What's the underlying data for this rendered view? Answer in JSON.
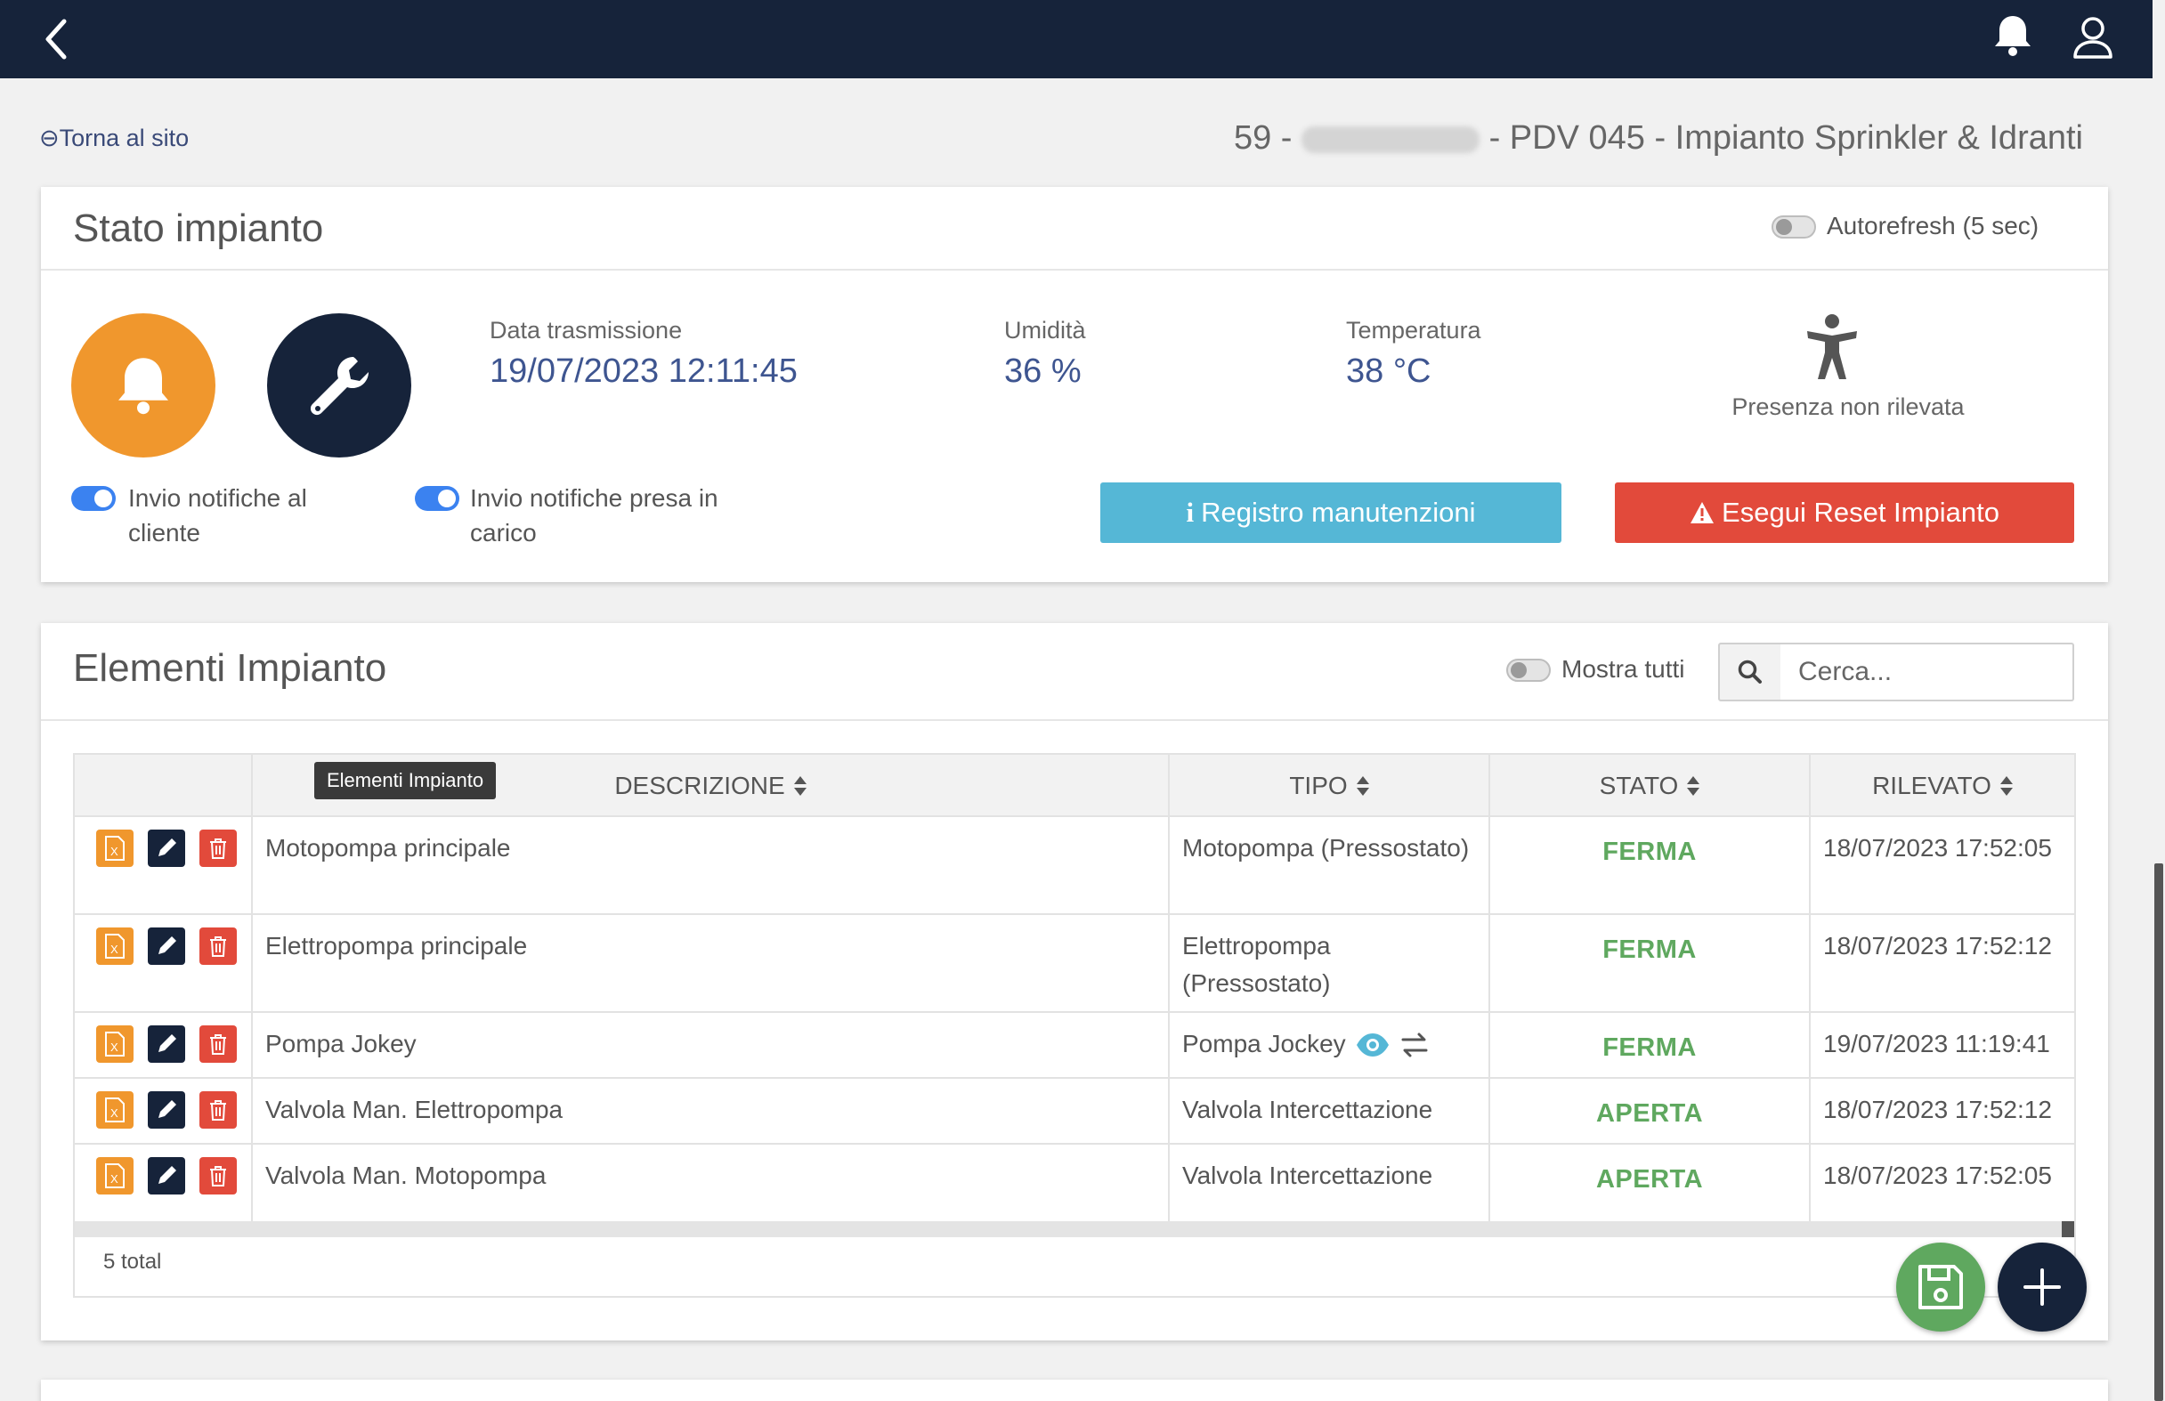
{
  "back_link": "⊖Torna al sito",
  "page_heading": {
    "prefix": "59 -",
    "suffix": "- PDV 045 - Impianto Sprinkler & Idranti"
  },
  "stato": {
    "title": "Stato impianto",
    "autorefresh_label": "Autorefresh (5 sec)",
    "toggle_client": "Invio notifiche al cliente",
    "toggle_presa": "Invio notifiche presa in carico",
    "data_trasmissione_label": "Data trasmissione",
    "data_trasmissione_value": "19/07/2023 12:11:45",
    "umidita_label": "Umidità",
    "umidita_value": "36 %",
    "temperatura_label": "Temperatura",
    "temperatura_value": "38 °C",
    "presenza_label": "Presenza non rilevata",
    "btn_registro": "Registro manutenzioni",
    "btn_reset": "Esegui Reset Impianto"
  },
  "elementi": {
    "title": "Elementi Impianto",
    "mostra_tutti": "Mostra tutti",
    "search_placeholder": "Cerca...",
    "tooltip": "Elementi Impianto",
    "columns": [
      "DESCRIZIONE",
      "TIPO",
      "STATO",
      "RILEVATO"
    ],
    "rows": [
      {
        "descrizione": "Motopompa principale",
        "tipo": "Motopompa (Pressostato)",
        "stato": "FERMA",
        "rilevato": "18/07/2023 17:52:05"
      },
      {
        "descrizione": "Elettropompa principale",
        "tipo": "Elettropompa (Pressostato)",
        "stato": "FERMA",
        "rilevato": "18/07/2023 17:52:12"
      },
      {
        "descrizione": "Pompa Jokey",
        "tipo": "Pompa Jockey",
        "stato": "FERMA",
        "rilevato": "19/07/2023 11:19:41"
      },
      {
        "descrizione": "Valvola Man. Elettropompa",
        "tipo": "Valvola Intercettazione",
        "stato": "APERTA",
        "rilevato": "18/07/2023 17:52:12"
      },
      {
        "descrizione": "Valvola Man. Motopompa",
        "tipo": "Valvola Intercettazione",
        "stato": "APERTA",
        "rilevato": "18/07/2023 17:52:05"
      }
    ],
    "total": "5 total"
  },
  "colors": {
    "navbar": "#16233a",
    "orange": "#f0972d",
    "info": "#55b7d6",
    "danger": "#e24a3b",
    "success": "#5fa85f",
    "toggle_on": "#3b82f0"
  }
}
